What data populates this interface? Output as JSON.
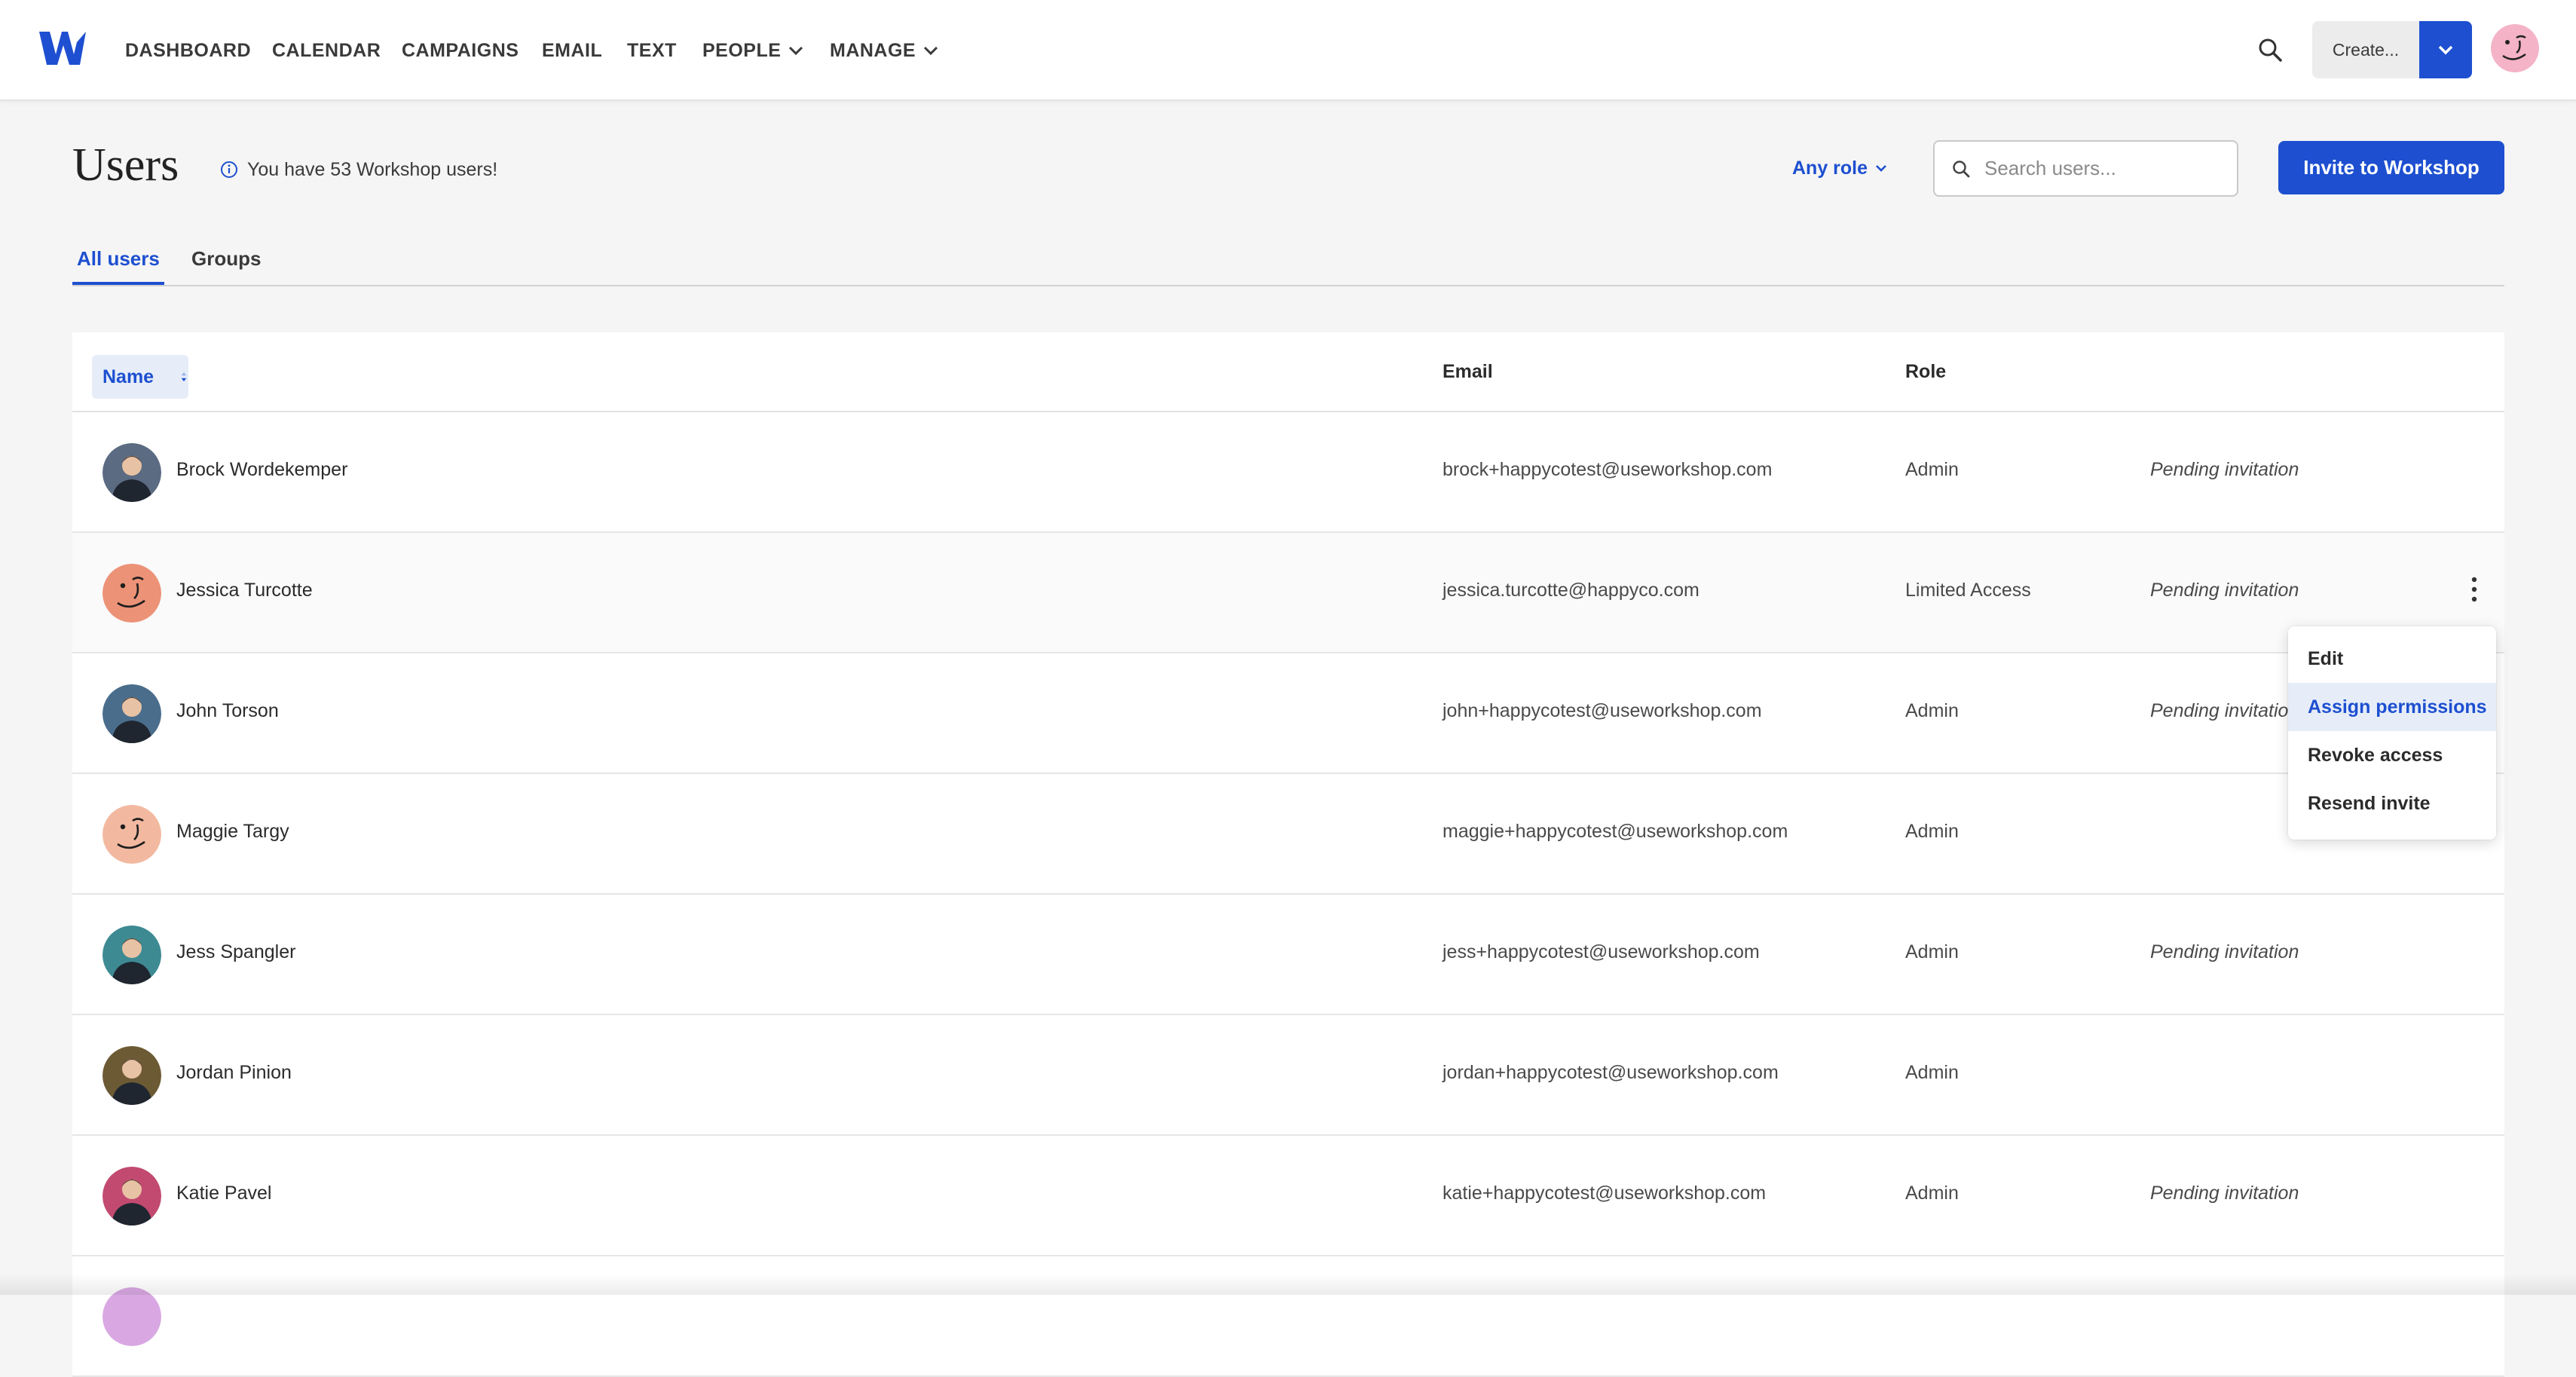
{
  "nav": {
    "items": [
      "DASHBOARD",
      "CALENDAR",
      "CAMPAIGNS",
      "EMAIL",
      "TEXT",
      "PEOPLE",
      "MANAGE"
    ],
    "create_label": "Create...",
    "icons": {
      "logo": "workshop-w-logo",
      "search": "search-icon",
      "dropdown": "chevron-down-icon"
    }
  },
  "header": {
    "title": "Users",
    "info": "You have 53 Workshop users!",
    "role_filter": "Any role",
    "search_placeholder": "Search users...",
    "invite_label": "Invite to Workshop"
  },
  "tabs": [
    {
      "label": "All users",
      "active": true
    },
    {
      "label": "Groups",
      "active": false
    }
  ],
  "table": {
    "columns": {
      "name": "Name",
      "email": "Email",
      "role": "Role"
    },
    "rows": [
      {
        "name": "Brock Wordekemper",
        "email": "brock+happycotest@useworkshop.com",
        "role": "Admin",
        "status": "Pending invitation",
        "avatar": "photo",
        "color": "#5b6b82"
      },
      {
        "name": "Jessica Turcotte",
        "email": "jessica.turcotte@happyco.com",
        "role": "Limited Access",
        "status": "Pending invitation",
        "avatar": "face",
        "color": "#ec9277"
      },
      {
        "name": "John Torson",
        "email": "john+happycotest@useworkshop.com",
        "role": "Admin",
        "status": "Pending invitation",
        "avatar": "photo",
        "color": "#4a6d8c"
      },
      {
        "name": "Maggie Targy",
        "email": "maggie+happycotest@useworkshop.com",
        "role": "Admin",
        "status": "",
        "avatar": "face",
        "color": "#f2b9a0"
      },
      {
        "name": "Jess Spangler",
        "email": "jess+happycotest@useworkshop.com",
        "role": "Admin",
        "status": "Pending invitation",
        "avatar": "photo",
        "color": "#3e8a93"
      },
      {
        "name": "Jordan Pinion",
        "email": "jordan+happycotest@useworkshop.com",
        "role": "Admin",
        "status": "",
        "avatar": "photo",
        "color": "#6c5a34"
      },
      {
        "name": "Katie Pavel",
        "email": "katie+happycotest@useworkshop.com",
        "role": "Admin",
        "status": "Pending invitation",
        "avatar": "photo",
        "color": "#c24a70"
      }
    ]
  },
  "row_menu": {
    "items": [
      "Edit",
      "Assign permissions",
      "Revoke access",
      "Resend invite"
    ],
    "highlighted": 1
  },
  "colors": {
    "accent": "#1d4fd0",
    "accent_light": "#e6edf9",
    "background": "#f5f5f5"
  }
}
